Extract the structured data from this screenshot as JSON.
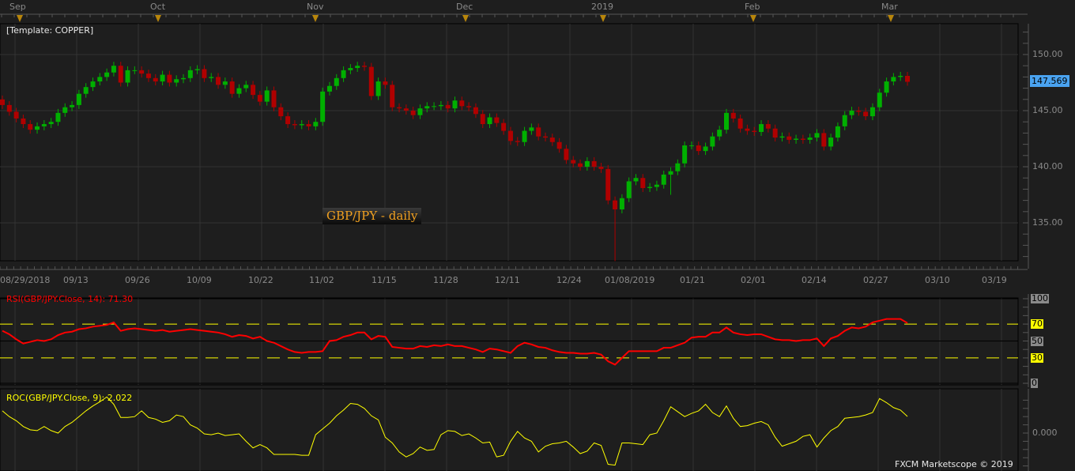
{
  "template_label": "[Template: COPPER]",
  "instrument_label": "GBP/JPY - daily",
  "copyright": "FXCM Marketscope © 2019",
  "colors": {
    "up": "#00b000",
    "down": "#b00000",
    "rsi": "#ff0000",
    "roc": "#ffff00",
    "last_price_bg": "#4aa3f0",
    "level_bg": "#ffff00",
    "grid": "#333333"
  },
  "chart_data": [
    {
      "type": "candlestick",
      "title": "GBP/JPY - daily",
      "months": [
        "Sep",
        "Oct",
        "Nov",
        "Dec",
        "2019",
        "Feb",
        "Mar"
      ],
      "date_labels": [
        "08/29/2018",
        "09/13",
        "09/26",
        "10/09",
        "10/22",
        "11/02",
        "11/15",
        "11/28",
        "12/11",
        "12/24",
        "01/08/2019",
        "01/21",
        "02/01",
        "02/14",
        "02/27",
        "03/10",
        "03/19"
      ],
      "y_ticks": [
        "150.00",
        "145.00",
        "140.00",
        "135.00"
      ],
      "ylim": [
        131,
        152
      ],
      "last_price": "147.569",
      "close": [
        145.5,
        144.9,
        144.3,
        143.8,
        143.3,
        143.6,
        143.8,
        144.0,
        144.8,
        145.3,
        145.5,
        146.5,
        147.1,
        147.6,
        148.0,
        148.4,
        149.0,
        147.5,
        148.6,
        148.6,
        148.3,
        147.9,
        147.6,
        148.2,
        147.5,
        147.8,
        147.9,
        148.6,
        148.7,
        147.9,
        148.0,
        147.3,
        147.6,
        146.5,
        147.0,
        147.3,
        146.4,
        145.8,
        146.8,
        145.3,
        144.5,
        143.8,
        143.7,
        143.8,
        143.6,
        144.0,
        146.7,
        147.2,
        147.9,
        148.6,
        148.8,
        149.0,
        148.9,
        146.3,
        147.6,
        147.3,
        145.3,
        145.2,
        145.0,
        144.6,
        145.2,
        145.4,
        145.4,
        145.5,
        145.2,
        145.9,
        145.4,
        145.3,
        144.7,
        143.8,
        144.4,
        143.9,
        143.2,
        142.3,
        142.2,
        143.2,
        143.5,
        142.7,
        142.6,
        142.2,
        141.6,
        140.6,
        140.3,
        140.0,
        140.5,
        140.0,
        139.8,
        137.0,
        136.2,
        137.2,
        138.7,
        139.0,
        138.1,
        138.2,
        138.4,
        139.3,
        139.6,
        140.3,
        141.9,
        141.9,
        141.4,
        141.8,
        142.7,
        143.3,
        144.8,
        144.3,
        143.4,
        143.2,
        143.1,
        143.8,
        143.4,
        142.6,
        142.7,
        142.4,
        142.5,
        142.4,
        142.6,
        143.0,
        141.8,
        142.6,
        143.6,
        144.6,
        145.0,
        144.9,
        144.5,
        145.3,
        146.6,
        147.6,
        148.0,
        148.1,
        147.569
      ],
      "first_open": 146.0,
      "low_overrides": {
        "88": 131.6,
        "96": 137.5
      }
    },
    {
      "type": "line",
      "label": "RSI(GBP/JPY.Close, 14): 71.30",
      "levels": [
        "100",
        "70",
        "50",
        "30",
        "0"
      ],
      "ylim": [
        0,
        100
      ],
      "values": [
        62,
        58,
        52,
        47,
        49,
        51,
        50,
        52,
        57,
        60,
        61,
        64,
        65,
        67,
        68,
        69,
        72,
        62,
        64,
        65,
        64,
        63,
        62,
        63,
        61,
        62,
        63,
        64,
        63,
        62,
        61,
        60,
        58,
        55,
        57,
        56,
        53,
        55,
        50,
        48,
        44,
        40,
        37,
        36,
        37,
        37,
        38,
        50,
        51,
        55,
        57,
        60,
        60,
        52,
        56,
        55,
        43,
        42,
        41,
        41,
        44,
        43,
        45,
        44,
        46,
        44,
        44,
        42,
        40,
        37,
        41,
        40,
        38,
        36,
        44,
        48,
        46,
        43,
        42,
        39,
        37,
        36,
        36,
        35,
        35,
        36,
        34,
        26,
        22,
        30,
        38,
        38,
        38,
        38,
        38,
        42,
        42,
        45,
        48,
        54,
        55,
        55,
        60,
        60,
        66,
        60,
        58,
        57,
        58,
        58,
        55,
        52,
        51,
        51,
        50,
        51,
        51,
        53,
        44,
        53,
        56,
        62,
        66,
        65,
        67,
        72,
        74,
        76,
        76,
        76,
        71.3
      ]
    },
    {
      "type": "line",
      "label": "ROC(GBP/JPY.Close, 9): 2.022",
      "y_ticks": [
        "0.000"
      ],
      "ylim": [
        -4,
        4.6
      ],
      "values": [
        2.7,
        2.0,
        1.5,
        0.8,
        0.4,
        0.3,
        0.8,
        0.3,
        0.0,
        0.8,
        1.3,
        2.0,
        2.7,
        3.3,
        3.8,
        4.4,
        3.5,
        1.9,
        1.9,
        2.0,
        2.7,
        1.9,
        1.7,
        1.3,
        1.5,
        2.2,
        2.0,
        1.0,
        0.6,
        -0.1,
        -0.2,
        0.0,
        -0.3,
        -0.2,
        -0.1,
        -1.0,
        -1.8,
        -1.4,
        -1.8,
        -2.6,
        -2.6,
        -2.6,
        -2.6,
        -2.7,
        -2.7,
        -0.2,
        0.5,
        1.2,
        2.1,
        2.8,
        3.6,
        3.5,
        3.0,
        2.1,
        1.6,
        -0.5,
        -1.2,
        -2.3,
        -2.9,
        -2.5,
        -1.7,
        -2.1,
        -2.0,
        -0.2,
        0.3,
        0.2,
        -0.3,
        -0.1,
        -0.6,
        -1.2,
        -1.1,
        -2.9,
        -2.7,
        -1.0,
        0.2,
        -0.6,
        -1.0,
        -2.3,
        -1.6,
        -1.3,
        -1.2,
        -1.0,
        -1.7,
        -2.5,
        -2.2,
        -1.2,
        -1.5,
        -3.8,
        -3.9,
        -1.2,
        -1.2,
        -1.3,
        -1.4,
        -0.2,
        0.0,
        1.5,
        3.2,
        2.6,
        2.0,
        2.4,
        2.7,
        3.5,
        2.5,
        2.0,
        3.3,
        1.8,
        0.8,
        0.9,
        1.2,
        1.4,
        1.0,
        -0.5,
        -1.6,
        -1.3,
        -1.0,
        -0.4,
        -0.2,
        -1.7,
        -0.6,
        0.3,
        0.8,
        1.8,
        1.9,
        2.0,
        2.2,
        2.5,
        4.2,
        3.7,
        3.1,
        2.8,
        2.022
      ]
    }
  ]
}
